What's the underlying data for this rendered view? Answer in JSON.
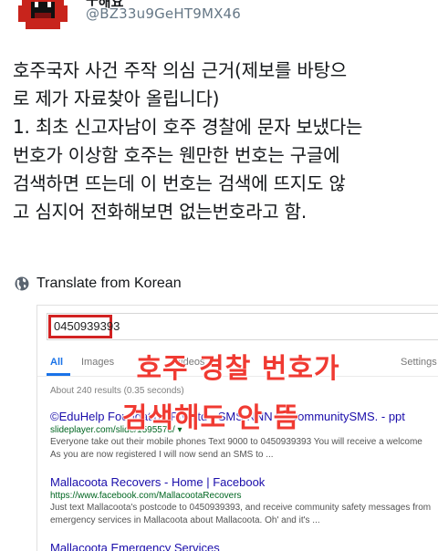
{
  "tweet": {
    "display_name": "ㅜ해요",
    "handle": "@BZ33u9GeHT9MX46",
    "text_lines": [
      "호주국자 사건 주작 의심 근거(제보를 바탕으",
      "로 제가 자료찾아 올립니다)",
      "1. 최초 신고자남이 호주 경찰에 문자 보냈다는",
      "번호가 이상함 호주는 웬만한 번호는 구글에",
      "검색하면 뜨는데 이 번호는 검색에 뜨지도 않",
      "고 심지어 전화해보면 없는번호라고 함."
    ],
    "translate_label": "Translate from Korean"
  },
  "screenshot": {
    "query": "0450939393",
    "tabs": [
      "All",
      "Images",
      "Videos",
      "Settings"
    ],
    "result_stats": "About 240 results (0.35 seconds)",
    "overlay_line1": "호주 경찰 번호가",
    "overlay_line2": "검색해도 안 뜸",
    "results": [
      {
        "title": "©EduHelp Foundation Pty Ltd - SMS NNN to CommunitySMS. - ppt",
        "url": "slideplayer.com/slide/1595578/ ▾",
        "snippet_lines": [
          "Everyone take out their mobile phones Text 9000 to 0450939393 You will receive a welcome",
          "As you are now registered I will now send an SMS to ..."
        ]
      },
      {
        "title": "Mallacoota Recovers - Home | Facebook",
        "url": "https://www.facebook.com/MallacootaRecovers",
        "snippet_lines": [
          "Just text Mallacoota's postcode to 0450939393, and receive community safety messages from",
          "emergency services in Mallacoota about Mallacoota. Oh' and it's ..."
        ]
      },
      {
        "title": "Mallacoota Emergency Services",
        "url": "",
        "snippet_lines": []
      }
    ]
  },
  "colors": {
    "overlay_red": "#f03a32",
    "link_blue": "#1a0dab",
    "url_green": "#006621",
    "highlight_red": "#d22222"
  }
}
